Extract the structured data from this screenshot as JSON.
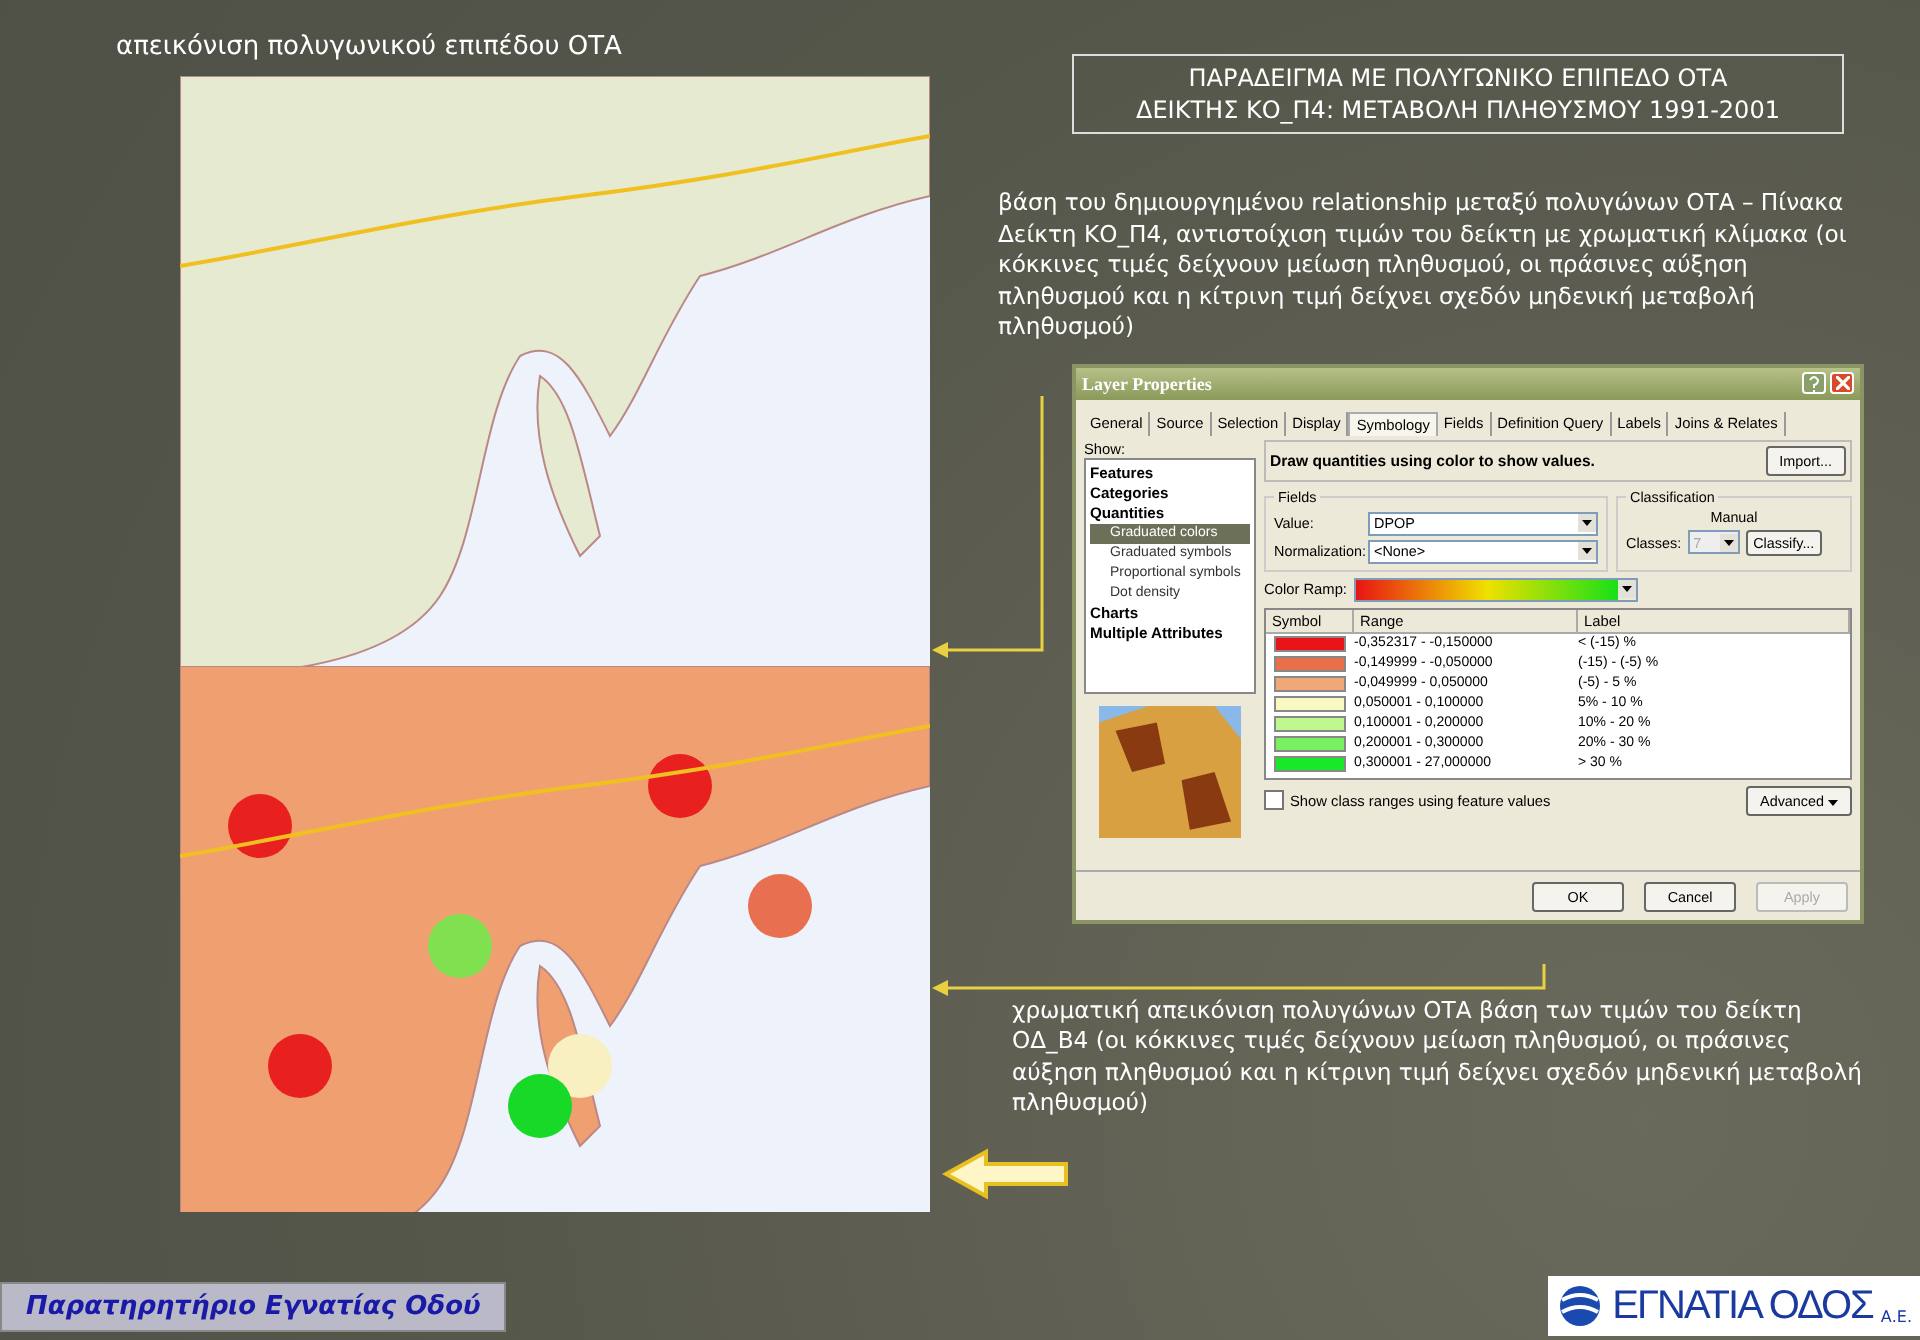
{
  "slide": {
    "heading": "απεικόνιση πολυγωνικού επιπέδου ΟΤΑ",
    "title_lines": [
      "ΠΑΡΑΔΕΙΓΜΑ ΜΕ ΠΟΛΥΓΩΝΙΚΟ ΕΠΙΠΕΔΟ ΟΤΑ",
      "ΔΕΙΚΤΗΣ ΚΟ_Π4: ΜΕΤΑΒΟΛΗ ΠΛΗΘΥΣΜΟΥ 1991-2001"
    ],
    "description_top": "βάση του δημιουργημένου relationship μεταξύ πολυγώνων ΟΤΑ – Πίνακα Δείκτη ΚΟ_Π4, αντιστοίχιση τιμών του δείκτη με χρωματική κλίμακα (οι κόκκινες τιμές δείχνουν μείωση πληθυσμού, οι πράσινες αύξηση πληθυσμού και η κίτρινη τιμή δείχνει σχεδόν μηδενική μεταβολή πληθυσμού)",
    "description_bottom": "χρωματική απεικόνιση πολυγώνων ΟΤΑ βάση των τιμών του δείκτη ΟΔ_Β4 (οι κόκκινες τιμές δείχνουν μείωση πληθυσμού, οι πράσινες αύξηση πληθυσμού και η κίτρινη τιμή δείχνει σχεδόν μηδενική μεταβολή πληθυσμού)",
    "footer_label": "Παρατηρητήριο Εγνατίας Οδού",
    "logo_text": "ΕΓΝΑΤΙΑ ΟΔΟΣ",
    "logo_suffix": "Α.Ε."
  },
  "dialog": {
    "title": "Layer Properties",
    "tabs": [
      {
        "label": "General",
        "selected": false
      },
      {
        "label": "Source",
        "selected": false
      },
      {
        "label": "Selection",
        "selected": false
      },
      {
        "label": "Display",
        "selected": false
      },
      {
        "label": "Symbology",
        "selected": true
      },
      {
        "label": "Fields",
        "selected": false
      },
      {
        "label": "Definition Query",
        "selected": false
      },
      {
        "label": "Labels",
        "selected": false
      },
      {
        "label": "Joins & Relates",
        "selected": false
      }
    ],
    "show_label": "Show:",
    "tree": [
      {
        "label": "Features"
      },
      {
        "label": "Categories"
      },
      {
        "label": "Quantities",
        "children": [
          {
            "label": "Graduated colors",
            "selected": true
          },
          {
            "label": "Graduated symbols",
            "selected": false
          },
          {
            "label": "Proportional symbols",
            "selected": false
          },
          {
            "label": "Dot density",
            "selected": false
          }
        ]
      },
      {
        "label": "Charts"
      },
      {
        "label": "Multiple Attributes"
      }
    ],
    "header": "Draw quantities using color to show values.",
    "import_button": "Import...",
    "fields": {
      "legend": "Fields",
      "value_label": "Value:",
      "value": "DPOP",
      "normalization_label": "Normalization:",
      "normalization": "<None>"
    },
    "classification": {
      "legend": "Classification",
      "method": "Manual",
      "classes_label": "Classes:",
      "classes": "7",
      "classes_disabled": true,
      "classify_button": "Classify..."
    },
    "color_ramp_label": "Color Ramp:",
    "table": {
      "columns": [
        "Symbol",
        "Range",
        "Label"
      ],
      "rows": [
        {
          "color": "#e8141a",
          "range": "-0,352317 - -0,150000",
          "label": "< (-15) %"
        },
        {
          "color": "#e8704a",
          "range": "-0,149999 - -0,050000",
          "label": "(-15) - (-5) %"
        },
        {
          "color": "#f0a878",
          "range": "-0,049999 - 0,050000",
          "label": "(-5) - 5 %"
        },
        {
          "color": "#f8f8c0",
          "range": "0,050001 - 0,100000",
          "label": "5% - 10 %"
        },
        {
          "color": "#c0f890",
          "range": "0,100001 - 0,200000",
          "label": "10% - 20 %"
        },
        {
          "color": "#78f060",
          "range": "0,200001 - 0,300000",
          "label": "20% - 30 %"
        },
        {
          "color": "#18e828",
          "range": "0,300001 - 27,000000",
          "label": "> 30 %"
        }
      ]
    },
    "show_class_ranges": {
      "label": "Show class ranges using feature values",
      "checked": false
    },
    "advanced_button": "Advanced",
    "buttons": [
      {
        "label": "OK",
        "disabled": false
      },
      {
        "label": "Cancel",
        "disabled": false
      },
      {
        "label": "Apply",
        "disabled": true
      }
    ]
  }
}
